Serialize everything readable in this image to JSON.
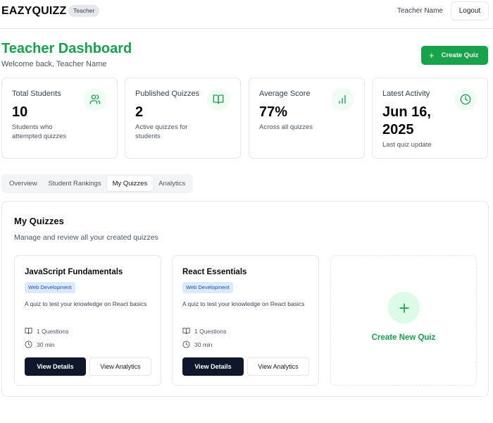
{
  "header": {
    "brand": "EAZYQUIZZ",
    "role_badge": "Teacher",
    "user_name": "Teacher Name",
    "logout_label": "Logout"
  },
  "title": {
    "heading": "Teacher Dashboard",
    "welcome": "Welcome back, Teacher Name",
    "create_button": "Create Quiz"
  },
  "stats": [
    {
      "label": "Total Students",
      "value": "10",
      "sub": "Students who attempted quizzes",
      "icon": "users-icon"
    },
    {
      "label": "Published Quizzes",
      "value": "2",
      "sub": "Active quizzes for students",
      "icon": "book-open-icon"
    },
    {
      "label": "Average Score",
      "value": "77%",
      "sub": "Across all quizzes",
      "icon": "bar-chart-icon"
    },
    {
      "label": "Latest Activity",
      "value": "Jun 16, 2025",
      "sub": "Last quiz update",
      "icon": "clock-icon"
    }
  ],
  "tabs": [
    {
      "label": "Overview",
      "active": false
    },
    {
      "label": "Student Rankings",
      "active": false
    },
    {
      "label": "My Quizzes",
      "active": true
    },
    {
      "label": "Analytics",
      "active": false
    }
  ],
  "panel": {
    "title": "My Quizzes",
    "subtitle": "Manage and review all your created quizzes"
  },
  "quizzes": [
    {
      "title": "JavaScript Fundamentals",
      "tag": "Web Development",
      "description": "A quiz to test your knowledge on React basics",
      "questions": "1 Questions",
      "duration": "30 min",
      "view_details": "View Details",
      "view_analytics": "View Analytics"
    },
    {
      "title": "React Essentials",
      "tag": "Web Development",
      "description": "A quiz to test your knowledge on React basics",
      "questions": "1 Questions",
      "duration": "30 min",
      "view_details": "View Details",
      "view_analytics": "View Analytics"
    }
  ],
  "new_quiz": {
    "label": "Create New Quiz"
  },
  "colors": {
    "brand_green": "#16a34a",
    "dark_button": "#0f172a",
    "tag_bg": "#dbeafe",
    "tag_text": "#1d4ed8"
  }
}
